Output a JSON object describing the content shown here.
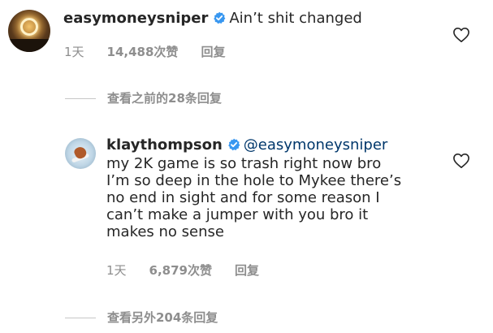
{
  "comment": {
    "username": "easymoneysniper",
    "text": "Ain’t shit changed",
    "time": "1天",
    "likes": "14,488次赞",
    "reply_label": "回复",
    "view_replies": "查看之前的28条回复"
  },
  "reply": {
    "username": "klaythompson",
    "mention": "@easymoneysniper",
    "lines": [
      "my 2K game is so trash right now bro",
      "I’m so deep in the hole to Mykee there’s",
      "no end in sight and for some reason I",
      "can’t make a jumper with you bro it",
      "makes no sense"
    ],
    "time": "1天",
    "likes": "6,879次赞",
    "reply_label": "回复"
  },
  "footer": {
    "view_replies": "查看另外204条回复"
  },
  "colors": {
    "text": "#262626",
    "muted": "#8e8e8e",
    "verified": "#3897f0",
    "mention": "#00376b"
  },
  "icons": {
    "verified": "verified-badge-icon",
    "like": "heart-outline-icon"
  }
}
